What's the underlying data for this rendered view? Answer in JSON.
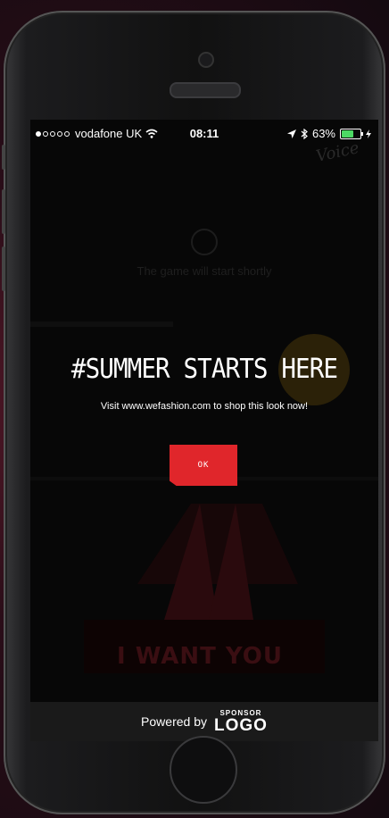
{
  "status_bar": {
    "carrier": "vodafone UK",
    "time": "08:11",
    "battery": "63%",
    "battery_level": 0.63,
    "signal_bars_filled": 1,
    "signal_bars_total": 5
  },
  "background": {
    "loading_text": "The game will start shortly",
    "scene_text": "I WANT YOU"
  },
  "dialog": {
    "headline": "#SUMMER STARTS HERE",
    "subline": "Visit www.wefashion.com to shop this look now!",
    "ok_label": "OK"
  },
  "footer": {
    "powered_by": "Powered by",
    "logo_small": "SPONSOR",
    "logo_big": "LOGO"
  },
  "colors": {
    "accent_red": "#e0262b",
    "battery_green": "#4cd964"
  }
}
